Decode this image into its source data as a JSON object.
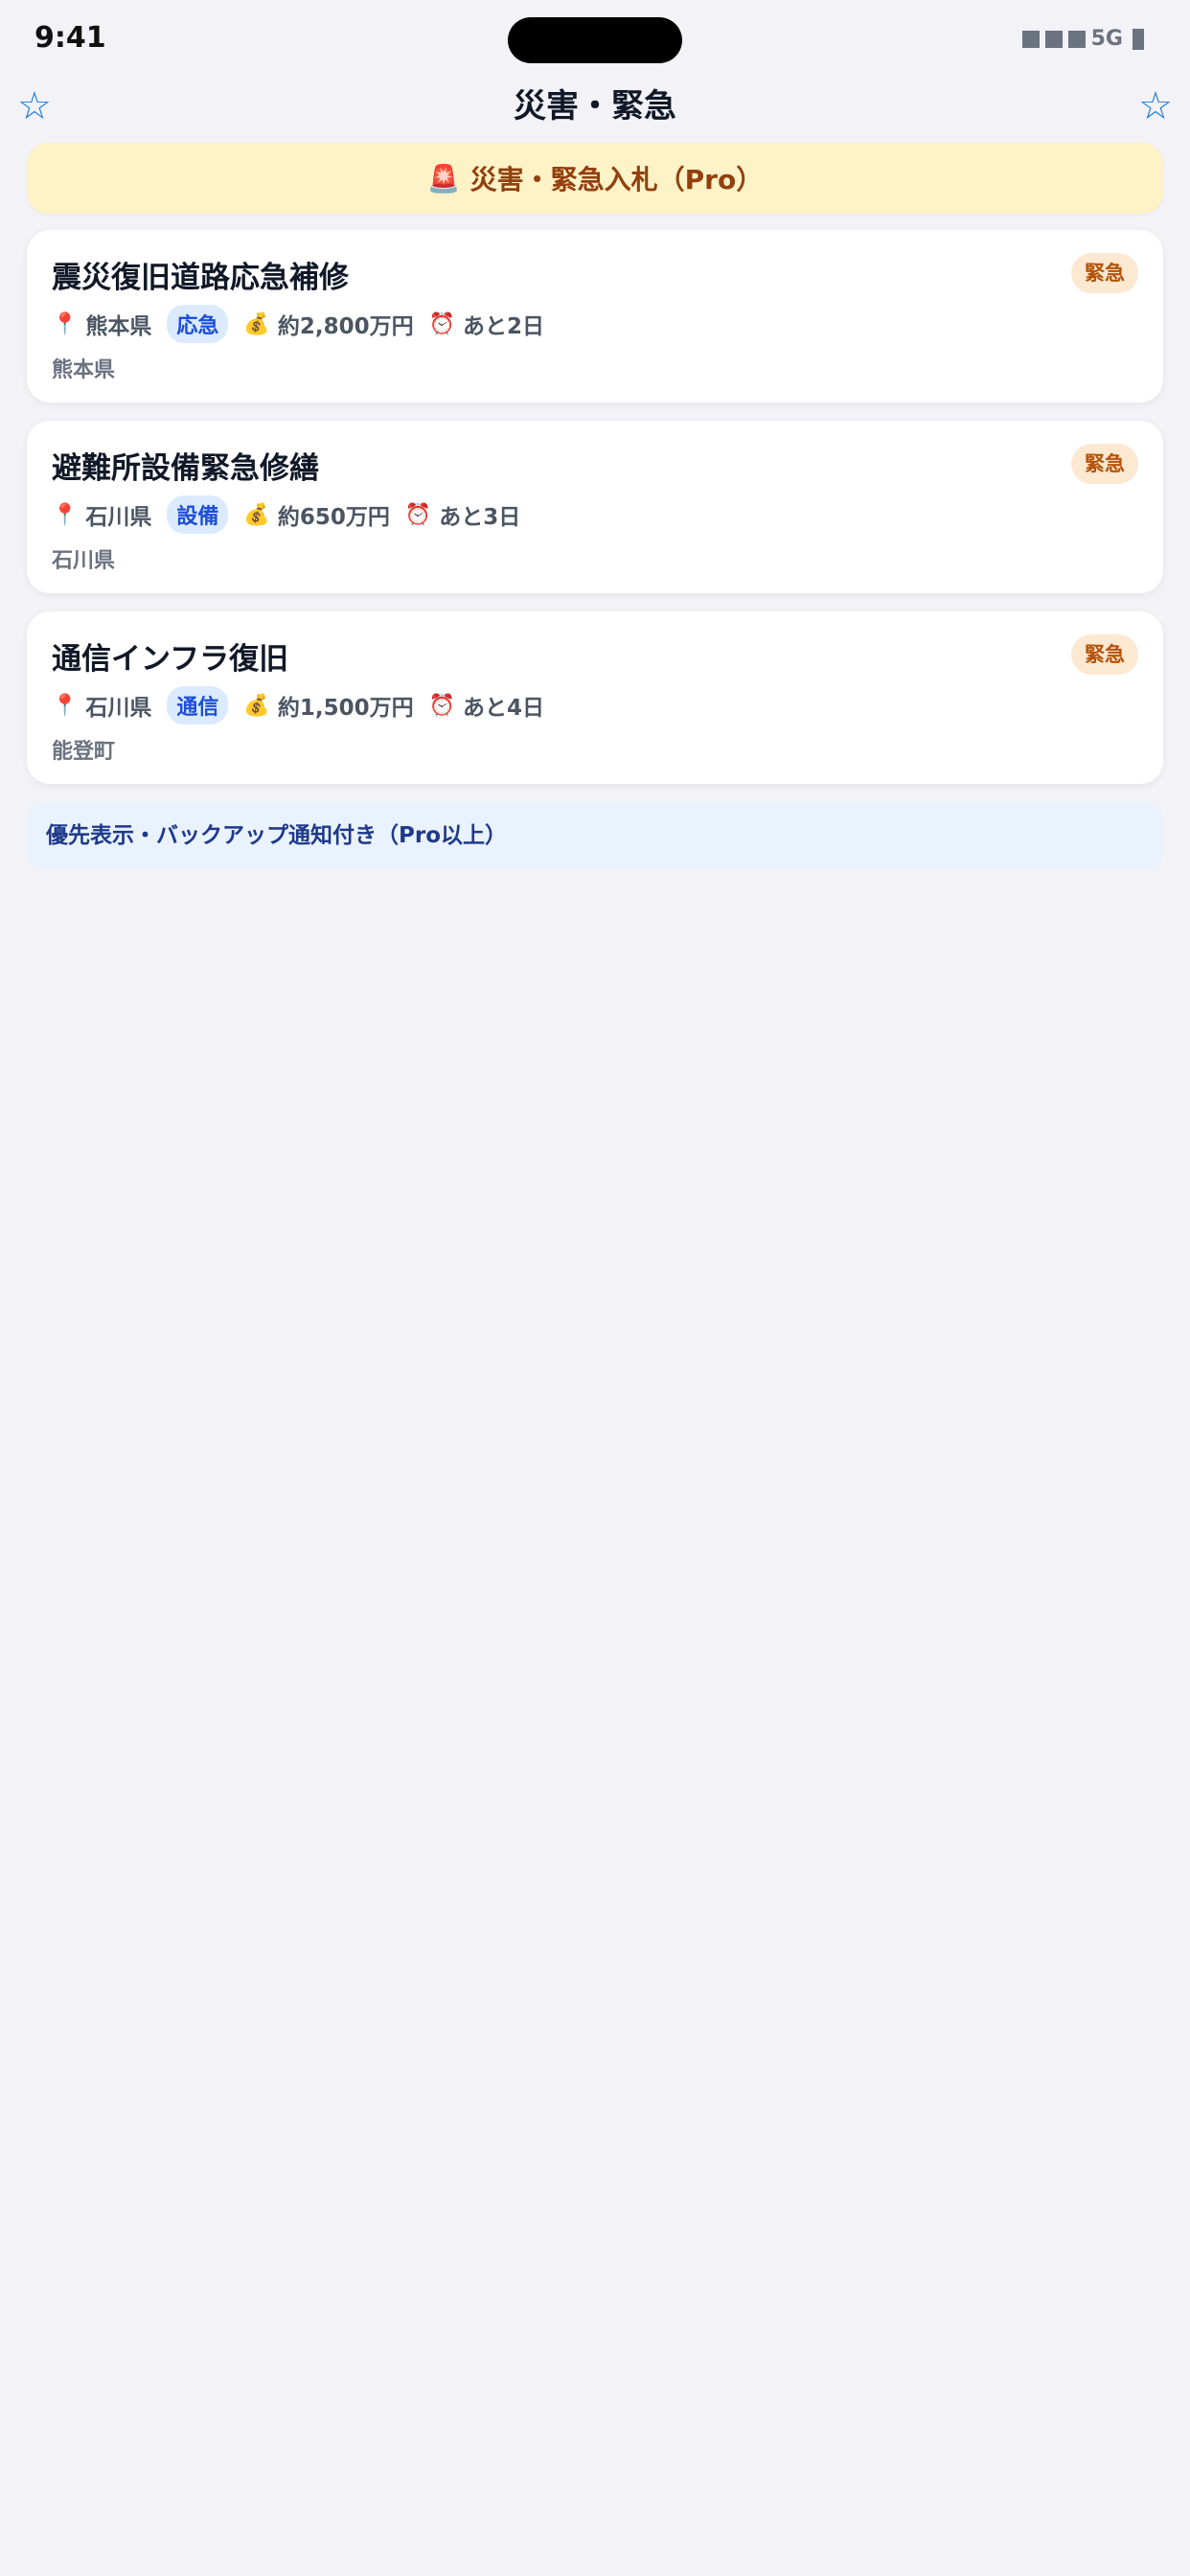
{
  "status": {
    "time": "9:41",
    "network": "5G"
  },
  "nav": {
    "title": "災害・緊急",
    "left_icon": "star-outline-icon",
    "right_icon": "star-outline-icon"
  },
  "banner": {
    "icon": "🚨",
    "text": "災害・緊急入札（Pro）"
  },
  "cards": [
    {
      "title": "震災復旧道路応急補修",
      "badge": "緊急",
      "pin": "📍",
      "prefecture": "熊本県",
      "category": "応急",
      "money_icon": "💰",
      "amount": "約2,800万円",
      "clock": "⏰",
      "deadline": "あと2日",
      "location": "熊本県"
    },
    {
      "title": "避難所設備緊急修繕",
      "badge": "緊急",
      "pin": "📍",
      "prefecture": "石川県",
      "category": "設備",
      "money_icon": "💰",
      "amount": "約650万円",
      "clock": "⏰",
      "deadline": "あと3日",
      "location": "石川県"
    },
    {
      "title": "通信インフラ復旧",
      "badge": "緊急",
      "pin": "📍",
      "prefecture": "石川県",
      "category": "通信",
      "money_icon": "💰",
      "amount": "約1,500万円",
      "clock": "⏰",
      "deadline": "あと4日",
      "location": "能登町"
    }
  ],
  "footer": {
    "note": "優先表示・バックアップ通知付き（Pro以上）"
  },
  "colors": {
    "accent": "#1d7bd6",
    "banner_bg": "#fef3c7",
    "badge_bg": "#fde8d2",
    "tag_bg": "#dbeafe"
  }
}
